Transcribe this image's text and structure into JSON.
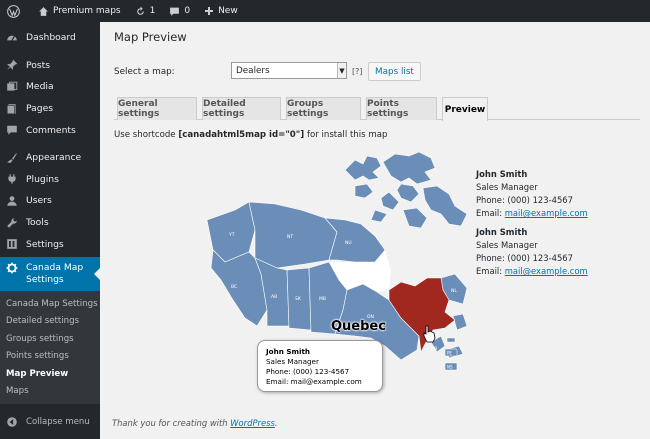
{
  "adminbar": {
    "site_name": "Premium maps",
    "updates_count": "1",
    "comments_count": "0",
    "new_label": "New"
  },
  "sidebar": {
    "items": [
      {
        "label": "Dashboard",
        "icon": "dashboard-icon"
      },
      {
        "label": "Posts",
        "icon": "pin-icon"
      },
      {
        "label": "Media",
        "icon": "media-icon"
      },
      {
        "label": "Pages",
        "icon": "pages-icon"
      },
      {
        "label": "Comments",
        "icon": "comment-icon"
      },
      {
        "label": "Appearance",
        "icon": "brush-icon"
      },
      {
        "label": "Plugins",
        "icon": "plug-icon"
      },
      {
        "label": "Users",
        "icon": "user-icon"
      },
      {
        "label": "Tools",
        "icon": "wrench-icon"
      },
      {
        "label": "Settings",
        "icon": "settings-icon"
      }
    ],
    "active": {
      "label_line1": "Canada Map",
      "label_line2": "Settings",
      "icon": "gear-icon"
    },
    "submenu": [
      "Canada Map Settings",
      "Detailed settings",
      "Groups settings",
      "Points settings",
      "Map Preview",
      "Maps"
    ],
    "collapse_label": "Collapse menu"
  },
  "main": {
    "title": "Map Preview",
    "select_label": "Select a map:",
    "selected_map": "Dealers",
    "help_mark": "[?]",
    "maps_list_label": "Maps list",
    "tabs": [
      {
        "label": "General settings"
      },
      {
        "label": "Detailed settings"
      },
      {
        "label": "Groups settings"
      },
      {
        "label": "Points settings"
      },
      {
        "label": "Preview"
      }
    ],
    "shortcode_prefix": "Use shortcode",
    "shortcode": "[canadahtml5map id=\"0\"]",
    "shortcode_suffix": "for install this map"
  },
  "map": {
    "hover_region": "Quebec",
    "region_color": "#6b8eb8",
    "highlight_color": "#a0281e",
    "province_labels": [
      "YT",
      "NT",
      "NU",
      "BC",
      "AB",
      "SK",
      "MB",
      "ON",
      "NL",
      "PE",
      "NS",
      "NB"
    ],
    "tooltip": {
      "name": "John Smith",
      "title": "Sales Manager",
      "phone": "Phone: (000) 123-4567",
      "email": "Email: mail@example.com"
    }
  },
  "contacts": [
    {
      "name": "John Smith",
      "title": "Sales Manager",
      "phone": "Phone: (000) 123-4567",
      "email_prefix": "Email:",
      "email": "mail@example.com"
    },
    {
      "name": "John Smith",
      "title": "Sales Manager",
      "phone": "Phone: (000) 123-4567",
      "email_prefix": "Email:",
      "email": "mail@example.com"
    }
  ],
  "footer": {
    "prefix": "Thank you for creating with",
    "link": "WordPress",
    "suffix": "."
  }
}
